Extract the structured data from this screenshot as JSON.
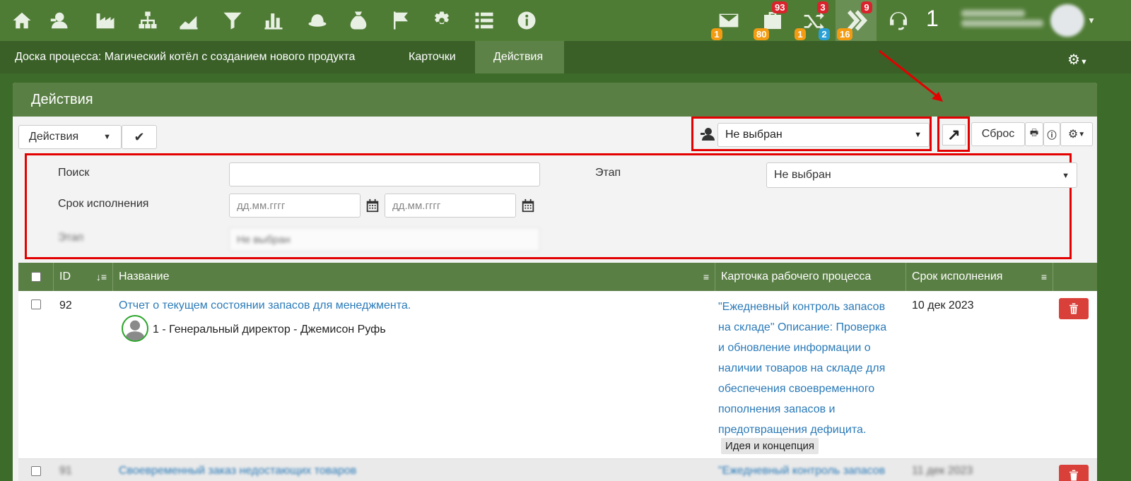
{
  "topbar": {
    "badges": {
      "mail_bottom": "1",
      "bag_top": "93",
      "bag_bottom": "80",
      "shuffle_top": "3",
      "shuffle_bottom_orange": "1",
      "shuffle_bottom_blue": "2",
      "forward_top": "9",
      "forward_bottom": "16"
    },
    "user_count": "1"
  },
  "subbar": {
    "board_title": "Доска процесса: Магический котёл с созданием нового продукта",
    "tab_cards": "Карточки",
    "tab_actions": "Действия"
  },
  "panel": {
    "title": "Действия",
    "actions_button": "Действия",
    "owner_select": "Не выбран",
    "reset_button": "Сброс"
  },
  "filters": {
    "search_label": "Поиск",
    "search_value": "",
    "due_label": "Срок исполнения",
    "date_from_placeholder": "дд.мм.гггг",
    "date_to_placeholder": "дд.мм.гггг",
    "stage_label": "Этап",
    "stage_value": "Не выбран",
    "hidden_label": "Этап",
    "hidden_value": "Не выбран"
  },
  "table": {
    "headers": {
      "id": "ID",
      "name": "Название",
      "card": "Карточка рабочего процесса",
      "due": "Срок исполнения"
    },
    "rows": [
      {
        "id": "92",
        "name": "Отчет о текущем состоянии запасов для менеджмента.",
        "assignee": "1 - Генеральный директор - Джемисон Руфь",
        "card_lines": [
          "\"Ежедневный контроль запасов",
          "на складе\" Описание: Проверка",
          "и обновление информации о",
          "наличии товаров на складе для",
          "обеспечения своевременного",
          "пополнения запасов и",
          "предотвращения дефицита."
        ],
        "stage": "Идея и концепция",
        "due": "10 дек 2023"
      },
      {
        "id": "91",
        "name": "Своевременный заказ недостающих товаров",
        "card": "\"Ежедневный контроль запасов",
        "due": "11 дек 2023"
      }
    ]
  },
  "colors": {
    "nav_green": "#4f7c35",
    "sub_green": "#3a6028",
    "header_green": "#5a7f45",
    "highlight_red": "#e30000",
    "delete_red": "#d9403a"
  }
}
